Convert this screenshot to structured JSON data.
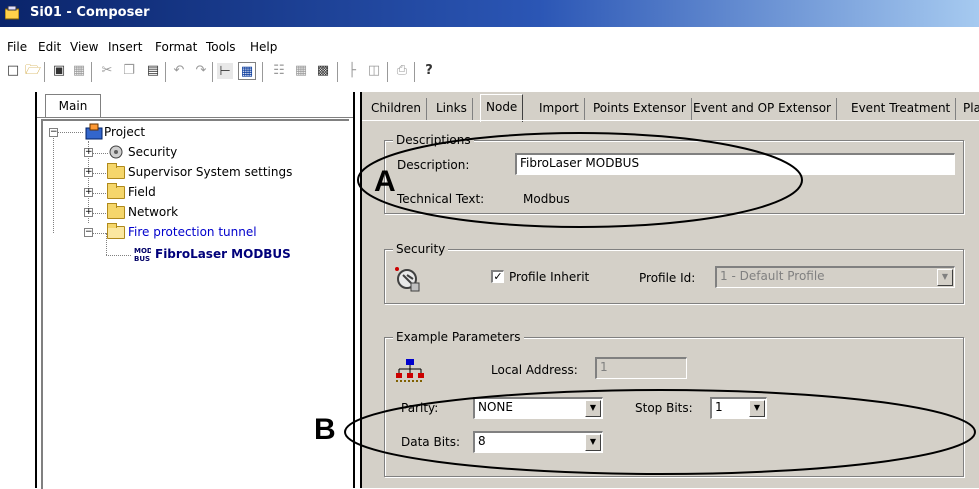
{
  "window": {
    "title": "Si01 - Composer"
  },
  "menu": [
    "File",
    "Edit",
    "View",
    "Insert",
    "Format",
    "Tools",
    "Help"
  ],
  "toolbar_icons": [
    "new-file-icon",
    "open-folder-icon",
    "properties-icon",
    "disabled-icon",
    "cut-icon",
    "copy-icon",
    "paste-icon",
    "undo-icon",
    "redo-icon",
    "tree-view-icon",
    "grid-view-icon",
    "network-icon",
    "table-icon",
    "layout-icon",
    "diagram-icon",
    "split-icon",
    "print-icon",
    "help-icon"
  ],
  "left_panel": {
    "tab": "Main",
    "tree": {
      "root": "Project",
      "items": [
        "Security",
        "Supervisor System settings",
        "Field",
        "Network",
        "Fire protection tunnel"
      ],
      "child": "FibroLaser MODBUS"
    }
  },
  "tabs": [
    "Children",
    "Links",
    "Node",
    "Import",
    "Points Extensor",
    "Event and OP Extensor",
    "Event Treatment",
    "Pla"
  ],
  "descriptions": {
    "title": "Descriptions",
    "description_label": "Description:",
    "description_value": "FibroLaser MODBUS",
    "technical_label": "Technical Text:",
    "technical_value": "Modbus"
  },
  "security": {
    "title": "Security",
    "profile_inherit_label": "Profile Inherit",
    "profile_id_label": "Profile Id:",
    "profile_id_value": "1 - Default Profile"
  },
  "example_parameters": {
    "title": "Example Parameters",
    "local_address_label": "Local Address:",
    "local_address_value": "1",
    "parity_label": "Parity:",
    "parity_value": "NONE",
    "stop_bits_label": "Stop Bits:",
    "stop_bits_value": "1",
    "data_bits_label": "Data Bits:",
    "data_bits_value": "8"
  },
  "callouts": {
    "a": "A",
    "b": "B"
  }
}
